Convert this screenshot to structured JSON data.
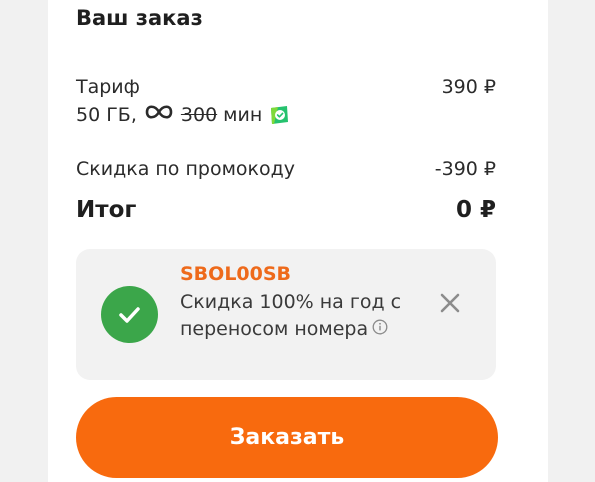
{
  "order": {
    "title": "Ваш заказ",
    "tariff": {
      "label": "Тариф",
      "price": "390 ₽",
      "data": "50 ГБ,",
      "infinity_symbol": "∞",
      "old_minutes": "300",
      "minutes_unit": "мин"
    },
    "discount": {
      "label": "Скидка по промокоду",
      "value": "-390 ₽"
    },
    "total": {
      "label": "Итог",
      "value": "0 ₽"
    },
    "promo": {
      "code": "SBOL00SB",
      "description": "Скидка 100% на год с переносом номера",
      "status_color": "#3ba64a",
      "code_color": "#ee6a1b"
    },
    "order_button": {
      "label": "Заказать",
      "color": "#f86a0e"
    }
  }
}
